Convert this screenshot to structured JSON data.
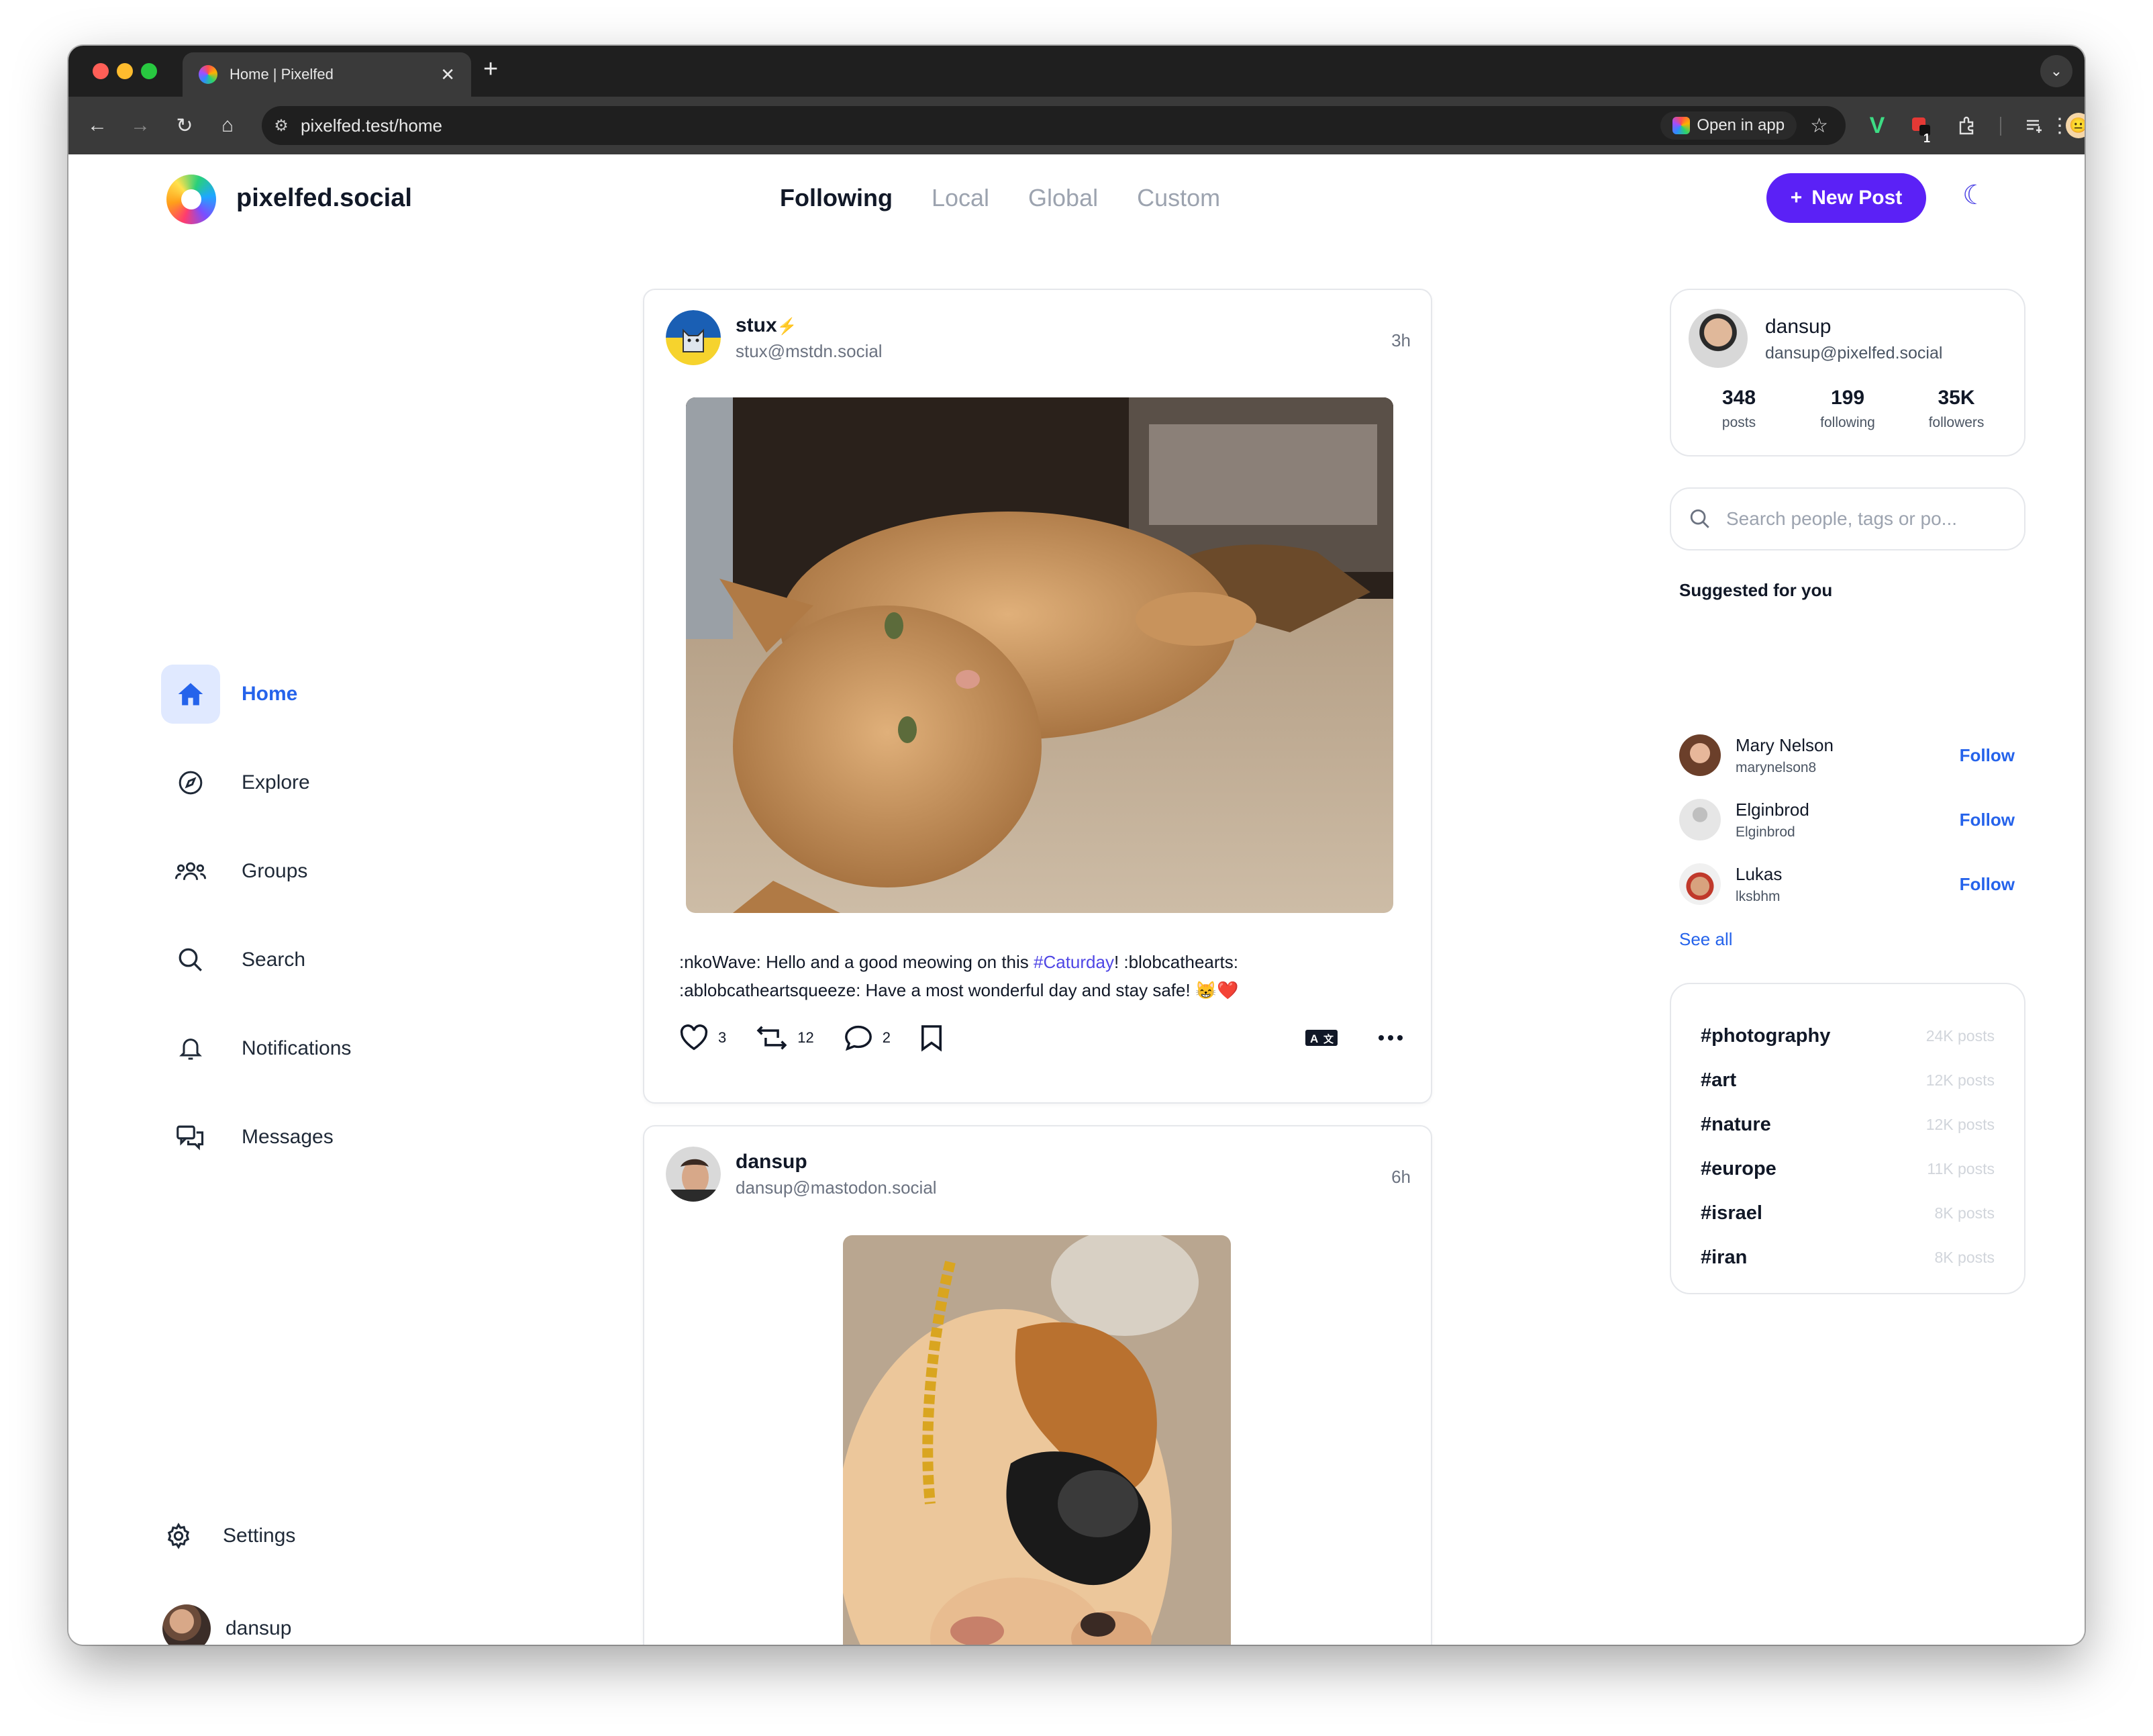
{
  "browser": {
    "tab_title": "Home | Pixelfed",
    "url": "pixelfed.test/home",
    "open_in_app": "Open in app",
    "ext_badge": "1"
  },
  "header": {
    "brand": "pixelfed.social",
    "tabs": [
      {
        "label": "Following",
        "active": true
      },
      {
        "label": "Local"
      },
      {
        "label": "Global"
      },
      {
        "label": "Custom"
      }
    ],
    "new_post": "New Post"
  },
  "sidebar": {
    "items": [
      {
        "label": "Home",
        "icon": "home-icon",
        "active": true
      },
      {
        "label": "Explore",
        "icon": "compass-icon"
      },
      {
        "label": "Groups",
        "icon": "groups-icon"
      },
      {
        "label": "Search",
        "icon": "search-icon"
      },
      {
        "label": "Notifications",
        "icon": "bell-icon"
      },
      {
        "label": "Messages",
        "icon": "messages-icon"
      }
    ],
    "settings": "Settings",
    "user": "dansup"
  },
  "feed": {
    "posts": [
      {
        "name": "stux",
        "badge": "⚡",
        "handle": "stux@mstdn.social",
        "time": "3h",
        "text_before": ":nkoWave: Hello and a good meowing on this ",
        "hashtag": "#Caturday",
        "text_after": "! :blobcathearts: :ablobcatheartsqueeze: Have a most wonderful day and stay safe! 😸❤️",
        "likes": "3",
        "boosts": "12",
        "comments": "2"
      },
      {
        "name": "dansup",
        "handle": "dansup@mastodon.social",
        "time": "6h"
      }
    ]
  },
  "profile": {
    "name": "dansup",
    "handle": "dansup@pixelfed.social",
    "stats": [
      {
        "num": "348",
        "label": "posts"
      },
      {
        "num": "199",
        "label": "following"
      },
      {
        "num": "35K",
        "label": "followers"
      }
    ]
  },
  "search": {
    "placeholder": "Search people, tags or po..."
  },
  "suggested": {
    "title": "Suggested for you",
    "follow_label": "Follow",
    "see_all": "See all",
    "users": [
      {
        "name": "Mary Nelson",
        "handle": "marynelson8"
      },
      {
        "name": "Elginbrod",
        "handle": "Elginbrod"
      },
      {
        "name": "Lukas",
        "handle": "lksbhm"
      }
    ]
  },
  "trending": [
    {
      "tag": "#photography",
      "count": "24K posts"
    },
    {
      "tag": "#art",
      "count": "12K posts"
    },
    {
      "tag": "#nature",
      "count": "12K posts"
    },
    {
      "tag": "#europe",
      "count": "11K posts"
    },
    {
      "tag": "#israel",
      "count": "8K posts"
    },
    {
      "tag": "#iran",
      "count": "8K posts"
    }
  ],
  "colors": {
    "accent": "#5b21f6",
    "link": "#2563eb",
    "hashtag": "#4f46e5"
  }
}
